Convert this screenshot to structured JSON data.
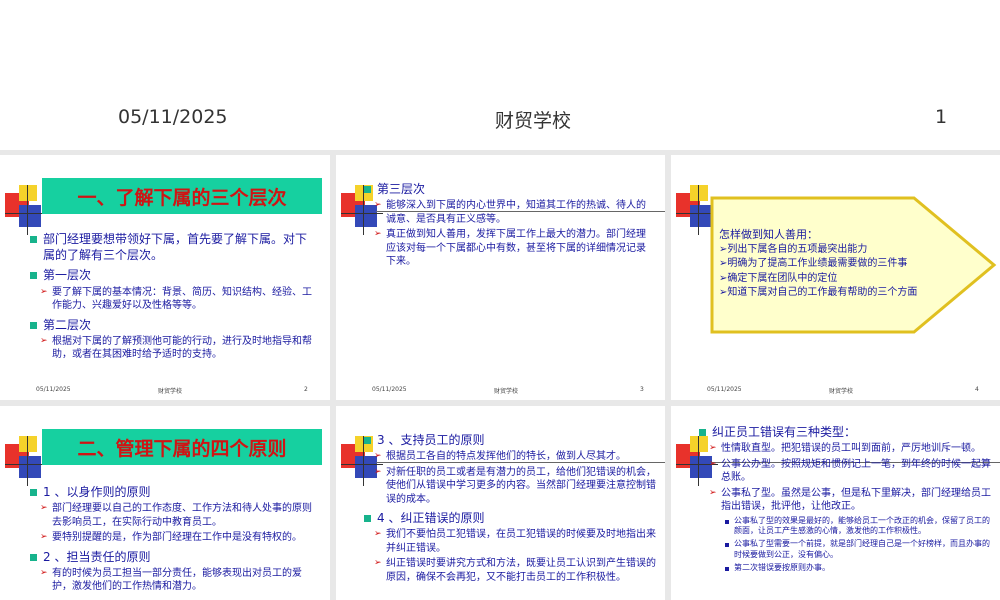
{
  "header": {
    "date": "05/11/2025",
    "title": "财贸学校",
    "page_number": "1"
  },
  "slide1": {
    "title": "一、了解下属的三个层次",
    "items": [
      {
        "level": 1,
        "text": "部门经理要想带领好下属，首先要了解下属。对下属的了解有三个层次。"
      },
      {
        "level": 1,
        "text": "第一层次"
      },
      {
        "level": 2,
        "text": "要了解下属的基本情况：背景、简历、知识结构、经验、工作能力、兴趣爱好以及性格等等。"
      },
      {
        "level": 1,
        "text": "第二层次"
      },
      {
        "level": 2,
        "text": "根据对下属的了解预测他可能的行动，进行及时地指导和帮助，或者在其困难时给予适时的支持。"
      }
    ],
    "footer": {
      "date": "05/11/2025",
      "school": "财贸学校",
      "page": "2"
    }
  },
  "slide2": {
    "items": [
      {
        "level": 1,
        "text": "第三层次"
      },
      {
        "level": 2,
        "text": "能够深入到下属的内心世界中，知道其工作的热诚、待人的诚意、是否具有正义感等。"
      },
      {
        "level": 2,
        "text": "真正做到知人善用，发挥下属工作上最大的潜力。部门经理应该对每一个下属都心中有数，甚至将下属的详细情况记录下来。"
      }
    ],
    "footer": {
      "date": "05/11/2025",
      "school": "财贸学校",
      "page": "3"
    }
  },
  "slide3": {
    "callout": {
      "heading": "怎样做到知人善用：",
      "lines": [
        "➢列出下属各自的五项最突出能力",
        "➢明确为了提高工作业绩最需要做的三件事",
        "➢确定下属在团队中的定位",
        "➢知道下属对自己的工作最有帮助的三个方面"
      ]
    },
    "footer": {
      "date": "05/11/2025",
      "school": "财贸学校",
      "page": "4"
    }
  },
  "slide4": {
    "title": "二、管理下属的四个原则",
    "items": [
      {
        "level": 1,
        "text": "1 、以身作则的原则"
      },
      {
        "level": 2,
        "text": "部门经理要以自己的工作态度、工作方法和待人处事的原则去影响员工，在实际行动中教育员工。"
      },
      {
        "level": 2,
        "text": "要特别提醒的是，作为部门经理在工作中是没有特权的。"
      },
      {
        "level": 1,
        "text": "2 、担当责任的原则"
      },
      {
        "level": 2,
        "text": "有的时候为员工担当一部分责任，能够表现出对员工的爱护，激发他们的工作热情和潜力。"
      }
    ]
  },
  "slide5": {
    "items": [
      {
        "level": 1,
        "text": "3 、支持员工的原则"
      },
      {
        "level": 2,
        "text": "根据员工各自的特点发挥他们的特长，做到人尽其才。"
      },
      {
        "level": 2,
        "text": "对新任职的员工或者是有潜力的员工，给他们犯错误的机会，使他们从错误中学习更多的内容。当然部门经理要注意控制错误的成本。"
      },
      {
        "level": 1,
        "text": "4 、纠正错误的原则"
      },
      {
        "level": 2,
        "text": "我们不要怕员工犯错误，在员工犯错误的时候要及时地指出来并纠正错误。"
      },
      {
        "level": 2,
        "text": "纠正错误时要讲究方式和方法，既要让员工认识到产生错误的原因，确保不会再犯，又不能打击员工的工作积极性。"
      }
    ]
  },
  "slide6": {
    "items": [
      {
        "level": 1,
        "text": "纠正员工错误有三种类型："
      },
      {
        "level": 2,
        "text": "性情耿直型。把犯错误的员工叫到面前，严厉地训斥一顿。"
      },
      {
        "level": 2,
        "text": "公事公办型。按照规矩和惯例记上一笔，到年终的时候一起算总账。"
      },
      {
        "level": 2,
        "text": "公事私了型。虽然是公事，但是私下里解决，部门经理给员工指出错误，批评他，让他改正。"
      },
      {
        "level": 3,
        "text": "公事私了型的效果是最好的，能够给员工一个改正的机会，保留了员工的颜面，让员工产生感激的心情，激发他的工作积极性。"
      },
      {
        "level": 3,
        "text": "公事私了型需要一个前提，就是部门经理自己是一个好榜样，而且办事的时候要做到公正，没有偏心。"
      },
      {
        "level": 3,
        "text": "第二次错误要按原则办事。"
      }
    ]
  },
  "colors": {
    "title_bg": "#16d0a0",
    "title_text": "#d01414",
    "body_text": "#1a1aa0",
    "bullet": "#17b38c",
    "arrow": "#d01414",
    "callout_bg": "#ffffcc",
    "callout_border": "#e0c020"
  }
}
